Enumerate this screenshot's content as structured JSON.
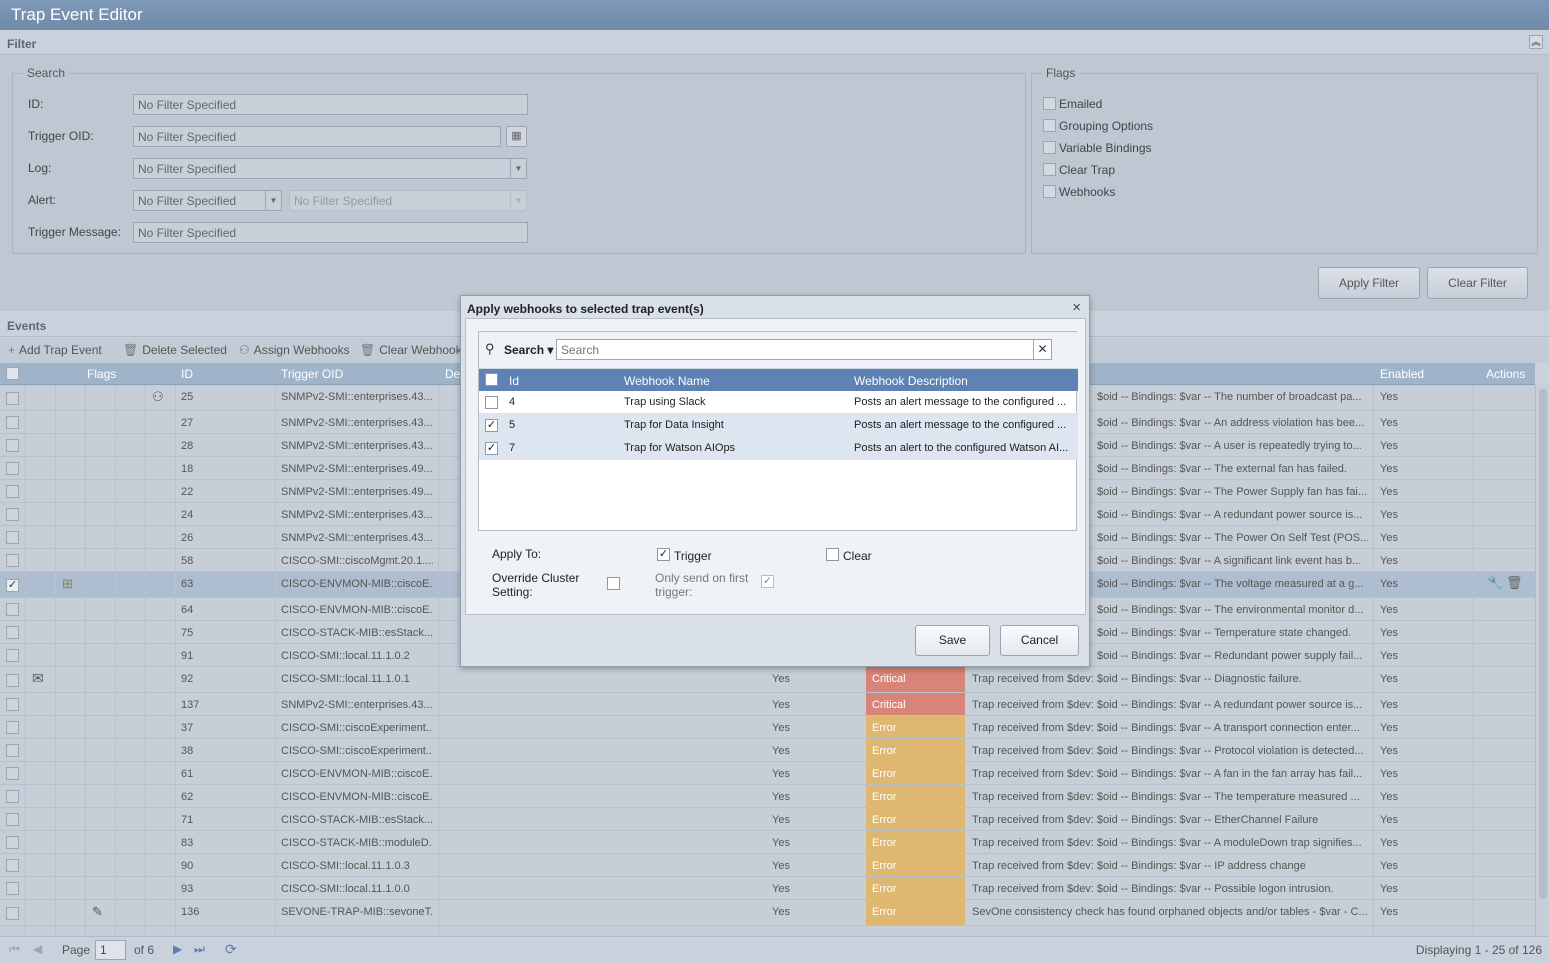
{
  "app": {
    "title": "Trap Event Editor"
  },
  "filter": {
    "title": "Filter",
    "search_legend": "Search",
    "flags_legend": "Flags",
    "id_label": "ID:",
    "id_placeholder": "No Filter Specified",
    "trigger_oid_label": "Trigger OID:",
    "trigger_oid_placeholder": "No Filter Specified",
    "log_label": "Log:",
    "log_value": "No Filter Specified",
    "alert_label": "Alert:",
    "alert_value": "No Filter Specified",
    "alert_sub_value": "No Filter Specified",
    "trigger_message_label": "Trigger Message:",
    "trigger_message_placeholder": "No Filter Specified",
    "flags": [
      "Emailed",
      "Grouping Options",
      "Variable Bindings",
      "Clear Trap",
      "Webhooks"
    ],
    "apply_button": "Apply Filter",
    "clear_button": "Clear Filter"
  },
  "events": {
    "title": "Events",
    "toolbar": {
      "add": "Add Trap Event",
      "delete": "Delete Selected",
      "assign": "Assign Webhooks",
      "clear": "Clear Webhooks"
    },
    "columns": {
      "flags": "Flags",
      "id": "ID",
      "trigger_oid": "Trigger OID",
      "description": "De",
      "enabled": "Enabled",
      "actions": "Actions"
    },
    "rows": [
      {
        "id": "25",
        "oid": "SNMPv2-SMI::enterprises.43...",
        "log": "",
        "sev": "",
        "msg": "$oid -- Bindings: $var -- The number of broadcast pa...",
        "en": "Yes",
        "icon": "webhook",
        "selected": false
      },
      {
        "id": "27",
        "oid": "SNMPv2-SMI::enterprises.43...",
        "log": "",
        "sev": "",
        "msg": "$oid -- Bindings: $var -- An address violation has bee...",
        "en": "Yes",
        "icon": "",
        "selected": false
      },
      {
        "id": "28",
        "oid": "SNMPv2-SMI::enterprises.43...",
        "log": "",
        "sev": "",
        "msg": "$oid -- Bindings: $var -- A user is repeatedly trying to...",
        "en": "Yes",
        "icon": "",
        "selected": false
      },
      {
        "id": "18",
        "oid": "SNMPv2-SMI::enterprises.49...",
        "log": "",
        "sev": "",
        "msg": "$oid -- Bindings: $var -- The external fan has failed.",
        "en": "Yes",
        "icon": "",
        "selected": false
      },
      {
        "id": "22",
        "oid": "SNMPv2-SMI::enterprises.49...",
        "log": "",
        "sev": "",
        "msg": "$oid -- Bindings: $var -- The Power Supply fan has fai...",
        "en": "Yes",
        "icon": "",
        "selected": false
      },
      {
        "id": "24",
        "oid": "SNMPv2-SMI::enterprises.43...",
        "log": "",
        "sev": "",
        "msg": "$oid -- Bindings: $var -- A redundant power source is...",
        "en": "Yes",
        "icon": "",
        "selected": false
      },
      {
        "id": "26",
        "oid": "SNMPv2-SMI::enterprises.43...",
        "log": "",
        "sev": "",
        "msg": "$oid -- Bindings: $var -- The Power On Self Test (POS...",
        "en": "Yes",
        "icon": "",
        "selected": false
      },
      {
        "id": "58",
        "oid": "CISCO-SMI::ciscoMgmt.20.1....",
        "log": "",
        "sev": "",
        "msg": "$oid -- Bindings: $var -- A significant link event has b...",
        "en": "Yes",
        "icon": "",
        "selected": false
      },
      {
        "id": "63",
        "oid": "CISCO-ENVMON-MIB::ciscoE...",
        "log": "",
        "sev": "",
        "msg": "$oid -- Bindings: $var -- The voltage measured at a g...",
        "en": "Yes",
        "icon": "group",
        "selected": true
      },
      {
        "id": "64",
        "oid": "CISCO-ENVMON-MIB::ciscoE...",
        "log": "",
        "sev": "",
        "msg": "$oid -- Bindings: $var -- The environmental monitor d...",
        "en": "Yes",
        "icon": "",
        "selected": false
      },
      {
        "id": "75",
        "oid": "CISCO-STACK-MIB::esStack....",
        "log": "",
        "sev": "",
        "msg": "$oid -- Bindings: $var -- Temperature state changed.",
        "en": "Yes",
        "icon": "",
        "selected": false
      },
      {
        "id": "91",
        "oid": "CISCO-SMI::local.11.1.0.2",
        "log": "",
        "sev": "",
        "msg": "$oid -- Bindings: $var -- Redundant power supply fail...",
        "en": "Yes",
        "icon": "",
        "selected": false
      },
      {
        "id": "92",
        "oid": "CISCO-SMI::local.11.1.0.1",
        "log": "Yes",
        "sev": "Critical",
        "msg": "Trap received from $dev: $oid -- Bindings: $var -- Diagnostic failure.",
        "en": "Yes",
        "icon": "email",
        "selected": false
      },
      {
        "id": "137",
        "oid": "SNMPv2-SMI::enterprises.43...",
        "log": "Yes",
        "sev": "Critical",
        "msg": "Trap received from $dev: $oid -- Bindings: $var -- A redundant power source is...",
        "en": "Yes",
        "icon": "",
        "selected": false
      },
      {
        "id": "37",
        "oid": "CISCO-SMI::ciscoExperiment...",
        "log": "Yes",
        "sev": "Error",
        "msg": "Trap received from $dev: $oid -- Bindings: $var -- A transport connection enter...",
        "en": "Yes",
        "icon": "",
        "selected": false
      },
      {
        "id": "38",
        "oid": "CISCO-SMI::ciscoExperiment...",
        "log": "Yes",
        "sev": "Error",
        "msg": "Trap received from $dev: $oid -- Bindings: $var -- Protocol violation is detected...",
        "en": "Yes",
        "icon": "",
        "selected": false
      },
      {
        "id": "61",
        "oid": "CISCO-ENVMON-MIB::ciscoE...",
        "log": "Yes",
        "sev": "Error",
        "msg": "Trap received from $dev: $oid -- Bindings: $var -- A fan in the fan array has fail...",
        "en": "Yes",
        "icon": "",
        "selected": false
      },
      {
        "id": "62",
        "oid": "CISCO-ENVMON-MIB::ciscoE...",
        "log": "Yes",
        "sev": "Error",
        "msg": "Trap received from $dev: $oid -- Bindings: $var -- The temperature measured ...",
        "en": "Yes",
        "icon": "",
        "selected": false
      },
      {
        "id": "71",
        "oid": "CISCO-STACK-MIB::esStack....",
        "log": "Yes",
        "sev": "Error",
        "msg": "Trap received from $dev: $oid -- Bindings: $var -- EtherChannel Failure",
        "en": "Yes",
        "icon": "",
        "selected": false
      },
      {
        "id": "83",
        "oid": "CISCO-STACK-MIB::moduleD...",
        "log": "Yes",
        "sev": "Error",
        "msg": "Trap received from $dev: $oid -- Bindings: $var -- A moduleDown trap signifies...",
        "en": "Yes",
        "icon": "",
        "selected": false
      },
      {
        "id": "90",
        "oid": "CISCO-SMI::local.11.1.0.3",
        "log": "Yes",
        "sev": "Error",
        "msg": "Trap received from $dev: $oid -- Bindings: $var -- IP address change",
        "en": "Yes",
        "icon": "",
        "selected": false
      },
      {
        "id": "93",
        "oid": "CISCO-SMI::local.11.1.0.0",
        "log": "Yes",
        "sev": "Error",
        "msg": "Trap received from $dev: $oid -- Bindings: $var -- Possible logon intrusion.",
        "en": "Yes",
        "icon": "",
        "selected": false
      },
      {
        "id": "136",
        "oid": "SEVONE-TRAP-MIB::sevoneT...",
        "log": "Yes",
        "sev": "Error",
        "msg": "SevOne consistency check has found orphaned objects and/or tables - $var - C...",
        "en": "Yes",
        "icon": "varbind",
        "selected": false
      }
    ],
    "pager": {
      "page_label": "Page",
      "page_value": "1",
      "of_label": "of 6",
      "displaying": "Displaying 1 - 25 of 126"
    }
  },
  "dialog": {
    "title": "Apply webhooks to selected trap event(s)",
    "search_label": "Search",
    "search_placeholder": "Search",
    "columns": {
      "id": "Id",
      "name": "Webhook Name",
      "description": "Webhook Description"
    },
    "rows": [
      {
        "id": "4",
        "name": "Trap using Slack",
        "desc": "Posts an alert message to the configured ...",
        "checked": false
      },
      {
        "id": "5",
        "name": "Trap for Data Insight",
        "desc": "Posts an alert message to the configured ...",
        "checked": true
      },
      {
        "id": "7",
        "name": "Trap for Watson AIOps",
        "desc": "Posts an alert to the configured Watson AI...",
        "checked": true
      }
    ],
    "apply_to_label": "Apply To:",
    "trigger_label": "Trigger",
    "trigger_checked": true,
    "clear_label": "Clear",
    "clear_checked": false,
    "override_label": "Override Cluster Setting:",
    "override_checked": false,
    "only_first_label": "Only send on first trigger:",
    "only_first_checked": true,
    "save_button": "Save",
    "cancel_button": "Cancel"
  }
}
